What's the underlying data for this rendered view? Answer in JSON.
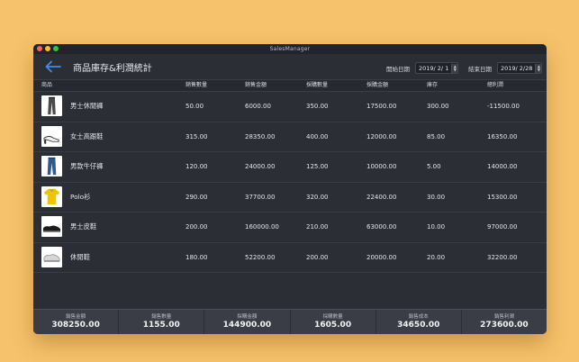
{
  "window": {
    "title": "SalesManager"
  },
  "header": {
    "title": "商品庫存&利潤統計",
    "start_label": "開始日期",
    "start_date": "2019/ 2/ 1",
    "end_label": "結束日期",
    "end_date": "2019/ 2/28"
  },
  "table": {
    "columns": [
      "商品",
      "銷售數量",
      "銷售金額",
      "採購數量",
      "採購金額",
      "庫存",
      "總利潤"
    ],
    "rows": [
      {
        "icon": "pants-thumbnail-icon",
        "name": "男士休閒褲",
        "sales_qty": "50.00",
        "sales_amt": "6000.00",
        "purchase_qty": "350.00",
        "purchase_amt": "17500.00",
        "stock": "300.00",
        "profit": "-11500.00"
      },
      {
        "icon": "heels-thumbnail-icon",
        "name": "女士高跟鞋",
        "sales_qty": "315.00",
        "sales_amt": "28350.00",
        "purchase_qty": "400.00",
        "purchase_amt": "12000.00",
        "stock": "85.00",
        "profit": "16350.00"
      },
      {
        "icon": "jeans-thumbnail-icon",
        "name": "男款牛仔褲",
        "sales_qty": "120.00",
        "sales_amt": "24000.00",
        "purchase_qty": "125.00",
        "purchase_amt": "10000.00",
        "stock": "5.00",
        "profit": "14000.00"
      },
      {
        "icon": "polo-shirt-thumbnail-icon",
        "name": "Polo衫",
        "sales_qty": "290.00",
        "sales_amt": "37700.00",
        "purchase_qty": "320.00",
        "purchase_amt": "22400.00",
        "stock": "30.00",
        "profit": "15300.00"
      },
      {
        "icon": "leather-shoes-thumbnail-icon",
        "name": "男士皮鞋",
        "sales_qty": "200.00",
        "sales_amt": "160000.00",
        "purchase_qty": "210.00",
        "purchase_amt": "63000.00",
        "stock": "10.00",
        "profit": "97000.00"
      },
      {
        "icon": "sneakers-thumbnail-icon",
        "name": "休閒鞋",
        "sales_qty": "180.00",
        "sales_amt": "52200.00",
        "purchase_qty": "200.00",
        "purchase_amt": "20000.00",
        "stock": "20.00",
        "profit": "32200.00"
      }
    ]
  },
  "footer": {
    "totals": [
      {
        "label": "銷售金額",
        "value": "308250.00"
      },
      {
        "label": "銷售數量",
        "value": "1155.00"
      },
      {
        "label": "採購金額",
        "value": "144900.00"
      },
      {
        "label": "採購數量",
        "value": "1605.00"
      },
      {
        "label": "銷售成本",
        "value": "34650.00"
      },
      {
        "label": "銷售利潤",
        "value": "273600.00"
      }
    ]
  },
  "colors": {
    "background": "#f6c26b",
    "window": "#2b2e35",
    "accent": "#3d8ee8",
    "close": "#fe5f57",
    "minimize": "#febc2e",
    "zoom": "#28c840"
  }
}
